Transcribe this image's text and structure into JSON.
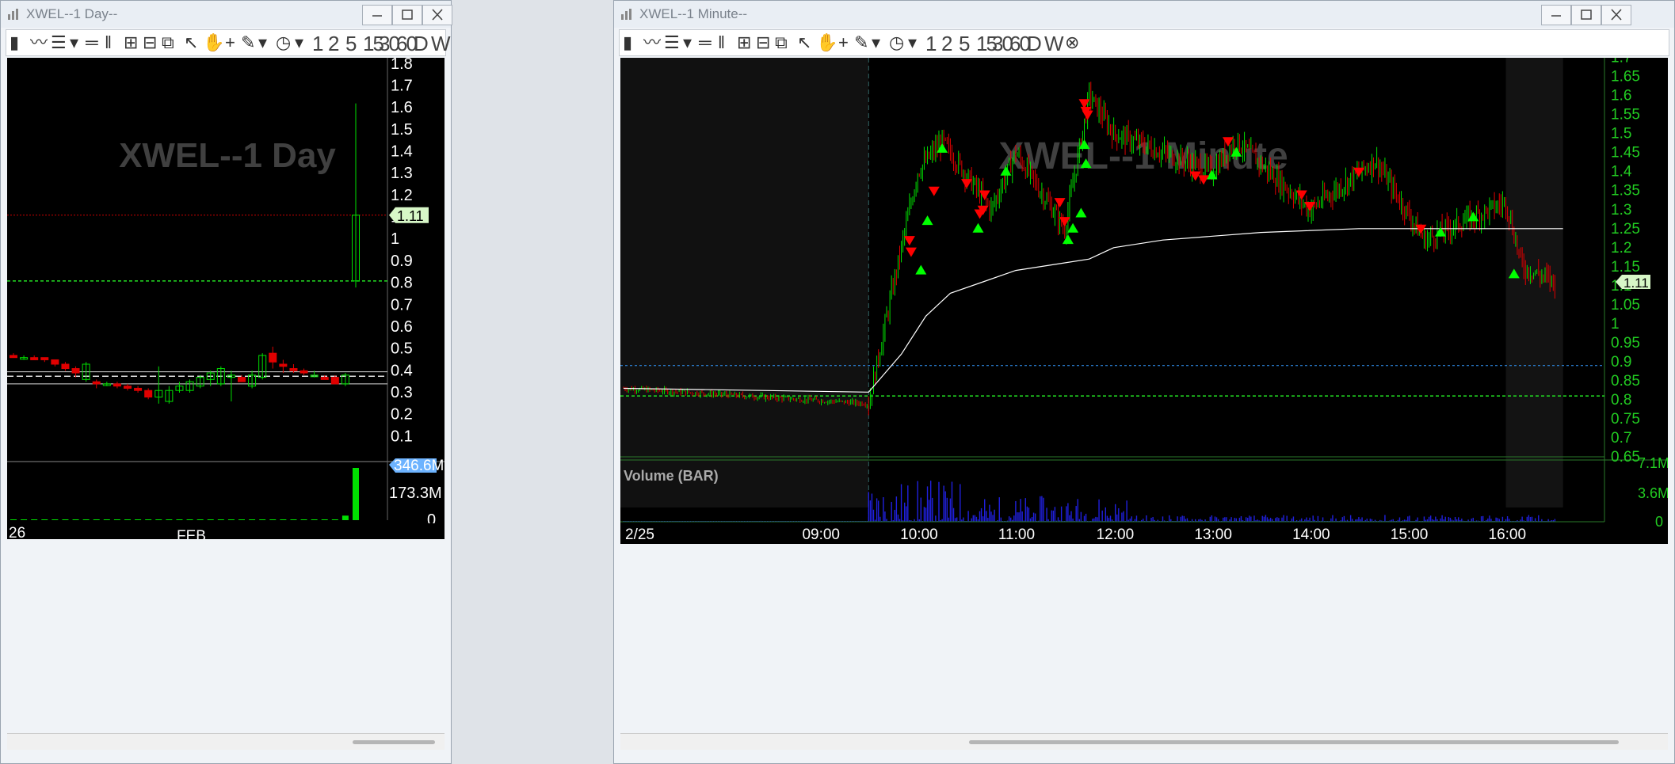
{
  "colors": {
    "up": "#00e000",
    "down": "#e00000",
    "ma": "#ffffff",
    "dashed_green": "#22dd22",
    "dashed_blue": "#3399ff",
    "axis_text": "#ffffff",
    "right_axis_text": "#22cc22",
    "watermark": "#404040",
    "price_label_bg": "#d7f7c7",
    "volume_label_bg": "#6db3ff",
    "volume_bar": "#2020dd"
  },
  "left_window": {
    "title": "XWEL--1 Day--",
    "watermark": "XWEL--1 Day",
    "toolbar": {
      "timeframes": [
        "1",
        "2",
        "5",
        "15",
        "30",
        "60",
        "D",
        "W"
      ]
    },
    "price_axis": {
      "ticks": [
        "1.8",
        "1.7",
        "1.6",
        "1.5",
        "1.4",
        "1.3",
        "1.2",
        "1.1",
        "1",
        "0.9",
        "0.8",
        "0.7",
        "0.6",
        "0.5",
        "0.4",
        "0.3",
        "0.2",
        "0.1"
      ],
      "current_price": "1.11"
    },
    "volume_axis": {
      "ticks": [
        "346.6M",
        "173.3M",
        "0"
      ]
    },
    "time_axis": {
      "labels": [
        "26",
        "FEB"
      ]
    }
  },
  "right_window": {
    "title": "XWEL--1 Minute--",
    "watermark": "XWEL--1 Minute",
    "toolbar": {
      "timeframes": [
        "1",
        "2",
        "5",
        "15",
        "30",
        "60",
        "D",
        "W"
      ]
    },
    "price_axis": {
      "ticks": [
        "1.7",
        "1.65",
        "1.6",
        "1.55",
        "1.5",
        "1.45",
        "1.4",
        "1.35",
        "1.3",
        "1.25",
        "1.2",
        "1.15",
        "1.1",
        "1.05",
        "1",
        "0.95",
        "0.9",
        "0.85",
        "0.8",
        "0.75",
        "0.7",
        "0.65"
      ],
      "current_price": "1.11"
    },
    "volume_panel": {
      "label": "Volume (BAR)",
      "ticks": [
        "7.1M",
        "3.6M",
        "0"
      ]
    },
    "time_axis": {
      "labels": [
        "2/25",
        "09:00",
        "10:00",
        "11:00",
        "12:00",
        "13:00",
        "14:00",
        "15:00",
        "16:00"
      ]
    }
  },
  "chart_data": [
    {
      "type": "candlestick",
      "title": "XWEL--1 Day",
      "ylim": [
        0,
        1.85
      ],
      "series": [
        {
          "name": "price",
          "ohlc": [
            [
              0.47,
              0.48,
              0.46,
              0.46
            ],
            [
              0.46,
              0.47,
              0.45,
              0.46
            ],
            [
              0.46,
              0.47,
              0.45,
              0.45
            ],
            [
              0.46,
              0.46,
              0.44,
              0.45
            ],
            [
              0.45,
              0.45,
              0.42,
              0.43
            ],
            [
              0.43,
              0.44,
              0.4,
              0.41
            ],
            [
              0.41,
              0.42,
              0.37,
              0.39
            ],
            [
              0.36,
              0.44,
              0.35,
              0.43
            ],
            [
              0.35,
              0.36,
              0.32,
              0.34
            ],
            [
              0.34,
              0.35,
              0.33,
              0.34
            ],
            [
              0.34,
              0.35,
              0.32,
              0.33
            ],
            [
              0.33,
              0.34,
              0.31,
              0.32
            ],
            [
              0.32,
              0.33,
              0.3,
              0.31
            ],
            [
              0.31,
              0.32,
              0.27,
              0.28
            ],
            [
              0.28,
              0.42,
              0.25,
              0.31
            ],
            [
              0.26,
              0.33,
              0.25,
              0.31
            ],
            [
              0.31,
              0.35,
              0.3,
              0.33
            ],
            [
              0.31,
              0.36,
              0.3,
              0.35
            ],
            [
              0.33,
              0.38,
              0.32,
              0.37
            ],
            [
              0.36,
              0.4,
              0.33,
              0.39
            ],
            [
              0.34,
              0.42,
              0.33,
              0.41
            ],
            [
              0.37,
              0.4,
              0.26,
              0.38
            ],
            [
              0.37,
              0.38,
              0.35,
              0.35
            ],
            [
              0.33,
              0.4,
              0.32,
              0.38
            ],
            [
              0.37,
              0.48,
              0.36,
              0.47
            ],
            [
              0.48,
              0.51,
              0.41,
              0.44
            ],
            [
              0.43,
              0.45,
              0.39,
              0.42
            ],
            [
              0.41,
              0.43,
              0.39,
              0.4
            ],
            [
              0.4,
              0.41,
              0.38,
              0.39
            ],
            [
              0.38,
              0.4,
              0.37,
              0.38
            ],
            [
              0.37,
              0.38,
              0.36,
              0.36
            ],
            [
              0.37,
              0.38,
              0.34,
              0.34
            ],
            [
              0.34,
              0.39,
              0.33,
              0.38
            ],
            [
              0.81,
              1.62,
              0.78,
              1.11
            ]
          ]
        }
      ],
      "volume": [
        3,
        2,
        2,
        2,
        2,
        3,
        2,
        4,
        3,
        2,
        2,
        2,
        2,
        3,
        5,
        3,
        2,
        2,
        2,
        3,
        3,
        4,
        2,
        2,
        4,
        5,
        3,
        2,
        2,
        2,
        2,
        3,
        30,
        346.6
      ],
      "levels": [
        1.11,
        0.81,
        0.39,
        0.37,
        0.34
      ]
    },
    {
      "type": "candlestick",
      "title": "XWEL--1 Minute",
      "ylim": [
        0.65,
        1.72
      ],
      "key_points": [
        [
          "07:00",
          0.83
        ],
        [
          "09:30",
          0.79
        ],
        [
          "09:45",
          1.1
        ],
        [
          "10:00",
          1.4
        ],
        [
          "10:15",
          1.48
        ],
        [
          "10:45",
          1.3
        ],
        [
          "11:00",
          1.45
        ],
        [
          "11:30",
          1.25
        ],
        [
          "11:45",
          1.6
        ],
        [
          "12:00",
          1.5
        ],
        [
          "13:00",
          1.4
        ],
        [
          "13:15",
          1.48
        ],
        [
          "14:00",
          1.3
        ],
        [
          "14:40",
          1.43
        ],
        [
          "15:10",
          1.22
        ],
        [
          "15:40",
          1.28
        ],
        [
          "16:00",
          1.32
        ],
        [
          "16:10",
          1.15
        ],
        [
          "16:30",
          1.11
        ]
      ],
      "vwap": [
        [
          "07:00",
          0.83
        ],
        [
          "09:30",
          0.82
        ],
        [
          "09:50",
          0.92
        ],
        [
          "10:05",
          1.02
        ],
        [
          "10:20",
          1.08
        ],
        [
          "10:40",
          1.11
        ],
        [
          "11:00",
          1.14
        ],
        [
          "11:30",
          1.16
        ],
        [
          "11:45",
          1.17
        ],
        [
          "12:00",
          1.2
        ],
        [
          "12:30",
          1.22
        ],
        [
          "13:30",
          1.24
        ],
        [
          "14:30",
          1.25
        ],
        [
          "15:30",
          1.25
        ],
        [
          "16:35",
          1.25
        ]
      ],
      "levels": {
        "blue_dashed": 0.89,
        "green_dashed": 0.81
      },
      "buy_signals_approx": 15,
      "sell_signals_approx": 17
    }
  ]
}
